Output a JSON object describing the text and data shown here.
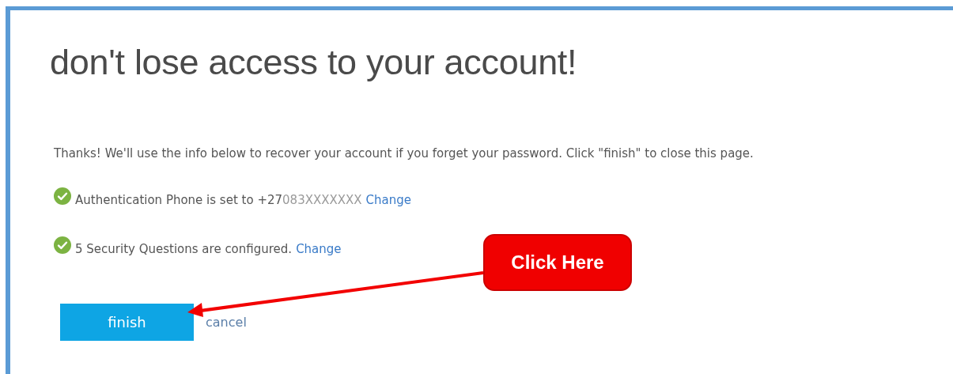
{
  "heading": "don't lose access to your account!",
  "intro": "Thanks! We'll use the info below to recover your account if you forget your password. Click \"finish\" to close this page.",
  "items": [
    {
      "checked": true,
      "text": "Authentication Phone is set to +27",
      "masked": "083XXXXXXX",
      "link": "Change"
    },
    {
      "checked": true,
      "text": "5 Security Questions are configured.",
      "link": "Change"
    }
  ],
  "buttons": {
    "finish": "finish",
    "cancel": "cancel"
  },
  "callout": {
    "text": "Click Here"
  }
}
